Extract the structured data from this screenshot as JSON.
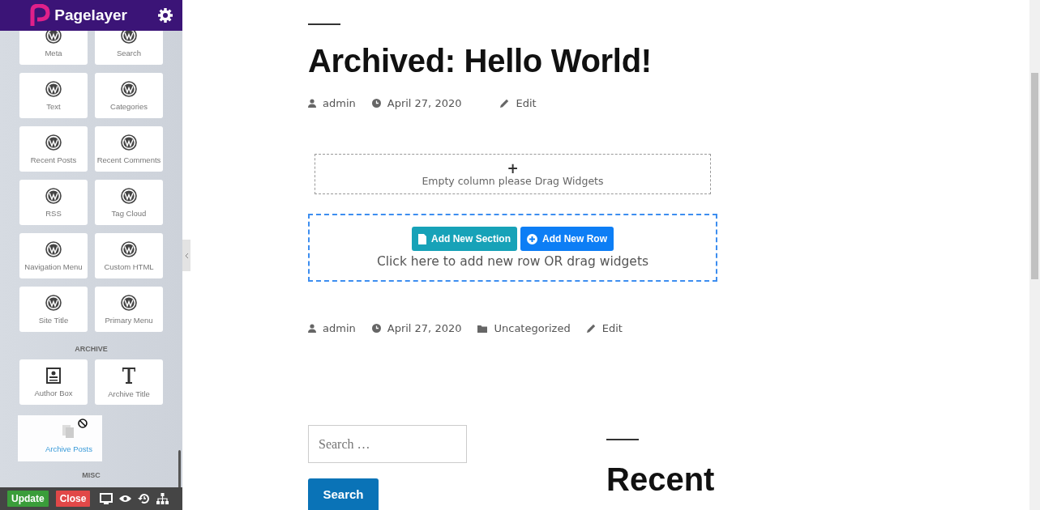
{
  "sidebar": {
    "brand": "Pagelayer",
    "widgets": [
      {
        "label": "Meta"
      },
      {
        "label": "Search"
      },
      {
        "label": "Text"
      },
      {
        "label": "Categories"
      },
      {
        "label": "Recent Posts"
      },
      {
        "label": "Recent Comments"
      },
      {
        "label": "RSS"
      },
      {
        "label": "Tag Cloud"
      },
      {
        "label": "Navigation Menu"
      },
      {
        "label": "Custom HTML"
      },
      {
        "label": "Site Title"
      },
      {
        "label": "Primary Menu"
      }
    ],
    "sections": [
      {
        "title": "ARCHIVE",
        "widgets": [
          {
            "label": "Author Box"
          },
          {
            "label": "Archive Title"
          }
        ]
      },
      {
        "title": "MISC"
      }
    ],
    "dragged": {
      "label": "Archive Posts"
    },
    "footer": {
      "buttons": [
        {
          "label": "Update",
          "kind": "update"
        },
        {
          "label": "Close",
          "kind": "close"
        }
      ]
    }
  },
  "post": {
    "title": "Archived: Hello World!",
    "meta_top": [
      {
        "kind": "author",
        "text": "admin"
      },
      {
        "kind": "date",
        "text": "April 27, 2020"
      },
      {
        "kind": "edit",
        "text": "Edit"
      }
    ],
    "empty_column": {
      "icon": "+",
      "text": "Empty column please Drag Widgets"
    },
    "add_row": {
      "buttons": [
        {
          "label": "Add New Section",
          "kind": "section"
        },
        {
          "label": "Add New Row",
          "kind": "row"
        }
      ],
      "hint": "Click here to add new row OR drag widgets"
    },
    "meta_bottom": [
      {
        "kind": "author",
        "text": "admin"
      },
      {
        "kind": "date",
        "text": "April 27, 2020"
      },
      {
        "kind": "category",
        "text": "Uncategorized"
      },
      {
        "kind": "edit",
        "text": "Edit"
      }
    ]
  },
  "search": {
    "placeholder": "Search …",
    "button": "Search"
  },
  "recent": {
    "heading": "Recent"
  }
}
